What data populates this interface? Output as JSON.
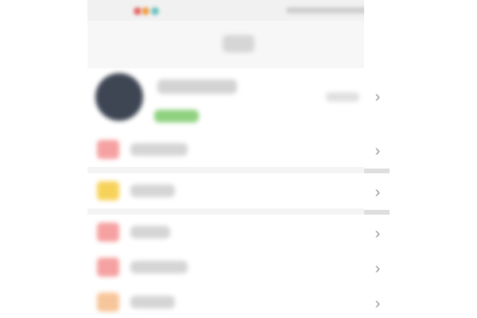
{
  "nav": {
    "title": ""
  },
  "profile": {
    "name": "",
    "badge": "",
    "extra": ""
  },
  "menu": [
    {
      "label": "",
      "icon": "menu-icon-red",
      "color": "#f6a1a1"
    },
    {
      "label": "",
      "icon": "menu-icon-yellow",
      "color": "#f7d25a"
    },
    {
      "label": "",
      "icon": "menu-icon-red",
      "color": "#f6a1a1"
    },
    {
      "label": "",
      "icon": "menu-icon-red",
      "color": "#f6a1a1"
    },
    {
      "label": "",
      "icon": "menu-icon-orange",
      "color": "#f7c59a"
    }
  ],
  "colors": {
    "avatar": "#3e4654",
    "badge": "#8fd17f"
  }
}
